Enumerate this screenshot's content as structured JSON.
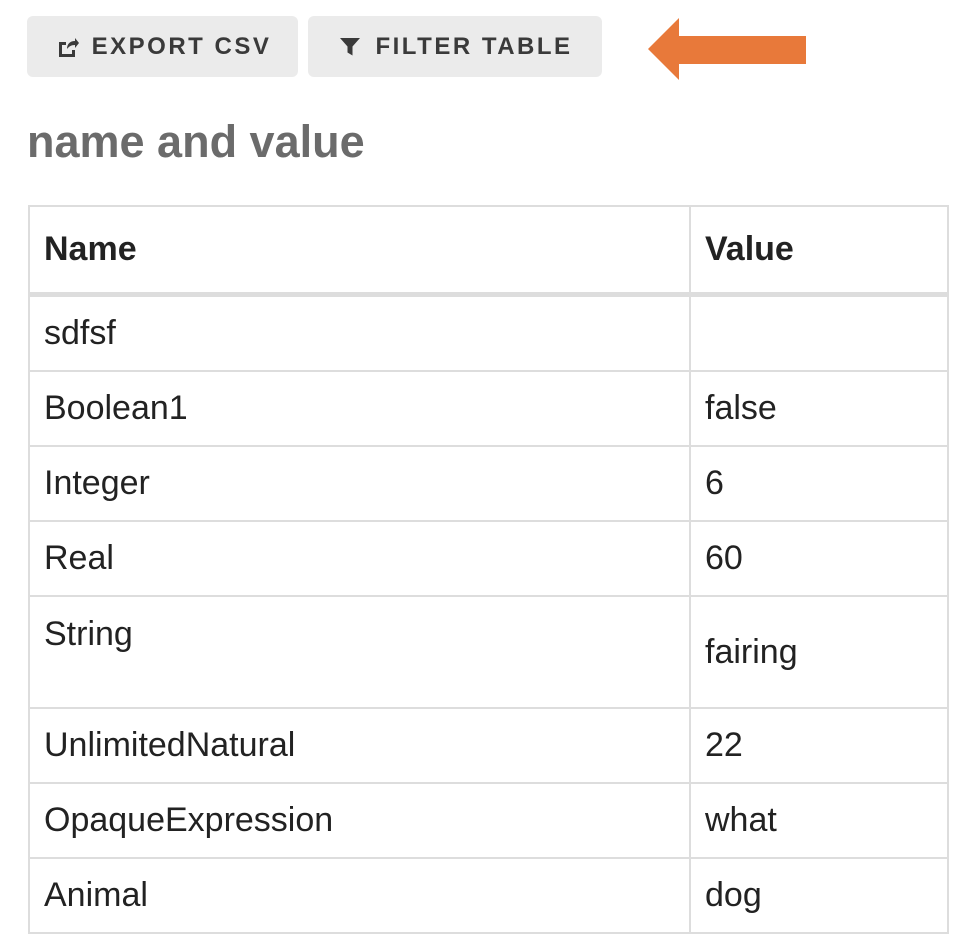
{
  "toolbar": {
    "export_label": "EXPORT CSV",
    "export_icon": "share-square-icon",
    "filter_label": "FILTER TABLE",
    "filter_icon": "funnel-icon"
  },
  "annotation": {
    "arrow_color": "#e8793a",
    "arrow_icon": "left-arrow-icon"
  },
  "section": {
    "title": "name and value"
  },
  "table": {
    "columns": [
      "Name",
      "Value"
    ],
    "rows": [
      {
        "name": "sdfsf",
        "value": ""
      },
      {
        "name": "Boolean1",
        "value": "false"
      },
      {
        "name": "Integer",
        "value": "6"
      },
      {
        "name": "Real",
        "value": "60"
      },
      {
        "name": "String",
        "value": "fairing"
      },
      {
        "name": "UnlimitedNatural",
        "value": "22"
      },
      {
        "name": "OpaqueExpression",
        "value": "what"
      },
      {
        "name": "Animal",
        "value": "dog"
      }
    ]
  },
  "colors": {
    "button_bg": "#ebebeb",
    "title_text": "#6b6b6b",
    "border": "#dddddd",
    "arrow": "#e8793a"
  }
}
